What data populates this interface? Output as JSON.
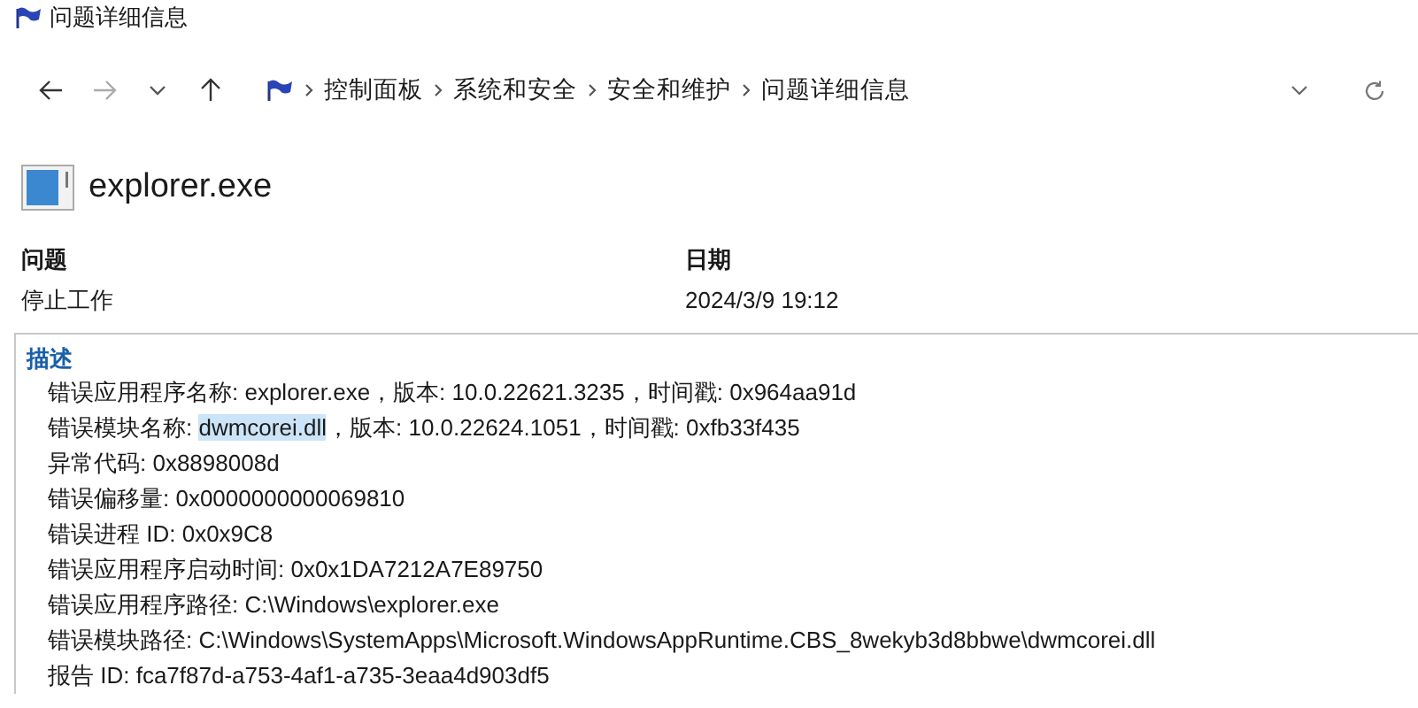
{
  "window": {
    "title": "问题详细信息"
  },
  "breadcrumb": [
    "控制面板",
    "系统和安全",
    "安全和维护",
    "问题详细信息"
  ],
  "app": {
    "name": "explorer.exe"
  },
  "summary": [
    {
      "label": "问题",
      "value": "停止工作"
    },
    {
      "label": "日期",
      "value": "2024/3/9 19:12"
    }
  ],
  "description": {
    "heading": "描述",
    "lines": [
      {
        "parts": [
          {
            "text": "错误应用程序名称: explorer.exe，版本: 10.0.22621.3235，时间戳: 0x964aa91d",
            "selected": false
          }
        ]
      },
      {
        "parts": [
          {
            "text": "错误模块名称: ",
            "selected": false
          },
          {
            "text": "dwmcorei.dll",
            "selected": true
          },
          {
            "text": "，版本: 10.0.22624.1051，时间戳: 0xfb33f435",
            "selected": false
          }
        ]
      },
      {
        "parts": [
          {
            "text": "异常代码: 0x8898008d",
            "selected": false
          }
        ]
      },
      {
        "parts": [
          {
            "text": "错误偏移量: 0x0000000000069810",
            "selected": false
          }
        ]
      },
      {
        "parts": [
          {
            "text": "错误进程 ID: 0x0x9C8",
            "selected": false
          }
        ]
      },
      {
        "parts": [
          {
            "text": "错误应用程序启动时间: 0x0x1DA7212A7E89750",
            "selected": false
          }
        ]
      },
      {
        "parts": [
          {
            "text": "错误应用程序路径: C:\\Windows\\explorer.exe",
            "selected": false
          }
        ]
      },
      {
        "parts": [
          {
            "text": "错误模块路径: C:\\Windows\\SystemApps\\Microsoft.WindowsAppRuntime.CBS_8wekyb3d8bbwe\\dwmcorei.dll",
            "selected": false
          }
        ]
      },
      {
        "parts": [
          {
            "text": "报告 ID: fca7f87d-a753-4af1-a735-3eaa4d903df5",
            "selected": false
          }
        ]
      }
    ]
  }
}
